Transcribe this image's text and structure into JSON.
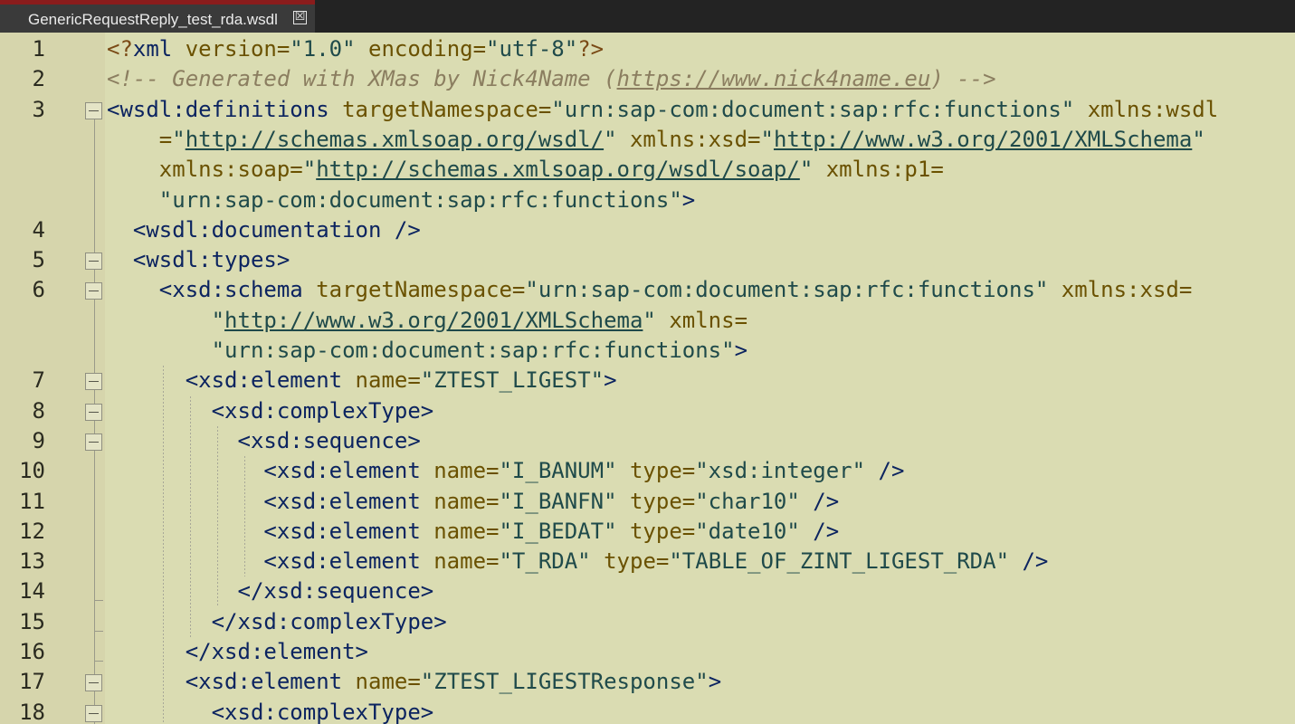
{
  "tab": {
    "title": "GenericRequestReply_test_rda.wsdl",
    "close_glyph": "☒"
  },
  "colors": {
    "editor_bg": "#dadcb2",
    "gutter_bg": "#d6d5ac",
    "tab_accent": "#8a1c1c",
    "tag": "#0c2460",
    "attr": "#6a5100",
    "value": "#1f4a4a",
    "comment": "#8b7e60"
  },
  "line_numbers": [
    "1",
    "2",
    "3",
    "4",
    "5",
    "6",
    "7",
    "8",
    "9",
    "10",
    "11",
    "12",
    "13",
    "14",
    "15",
    "16",
    "17",
    "18"
  ],
  "code": [
    {
      "seg": [
        [
          "pi",
          "<?"
        ],
        [
          "tag",
          "xml "
        ],
        [
          "attr",
          "version="
        ],
        [
          "val",
          "\"1.0\""
        ],
        [
          "attr",
          " encoding="
        ],
        [
          "val",
          "\"utf-8\""
        ],
        [
          "pi",
          "?>"
        ]
      ]
    },
    {
      "seg": [
        [
          "com",
          "<!-- Generated with XMas by Nick4Name ("
        ],
        [
          "com lnk",
          "https://www.nick4name.eu"
        ],
        [
          "com",
          ") -->"
        ]
      ]
    },
    {
      "seg": [
        [
          "tag",
          "<wsdl:definitions "
        ],
        [
          "attr",
          "targetNamespace="
        ],
        [
          "val",
          "\"urn:sap-com:document:sap:rfc:functions\""
        ],
        [
          "attr",
          " xmlns:wsdl"
        ]
      ]
    },
    {
      "seg": [
        [
          "attr",
          "    ="
        ],
        [
          "val",
          "\""
        ],
        [
          "val lnk",
          "http://schemas.xmlsoap.org/wsdl/"
        ],
        [
          "val",
          "\""
        ],
        [
          "attr",
          " xmlns:xsd="
        ],
        [
          "val",
          "\""
        ],
        [
          "val lnk",
          "http://www.w3.org/2001/XMLSchema"
        ],
        [
          "val",
          "\""
        ]
      ]
    },
    {
      "seg": [
        [
          "attr",
          "    xmlns:soap="
        ],
        [
          "val",
          "\""
        ],
        [
          "val lnk",
          "http://schemas.xmlsoap.org/wsdl/soap/"
        ],
        [
          "val",
          "\""
        ],
        [
          "attr",
          " xmlns:p1="
        ]
      ]
    },
    {
      "seg": [
        [
          "val",
          "    \"urn:sap-com:document:sap:rfc:functions\""
        ],
        [
          "tag",
          ">"
        ]
      ]
    },
    {
      "seg": [
        [
          "tag",
          "  <wsdl:documentation />"
        ]
      ]
    },
    {
      "seg": [
        [
          "tag",
          "  <wsdl:types>"
        ]
      ]
    },
    {
      "seg": [
        [
          "tag",
          "    <xsd:schema "
        ],
        [
          "attr",
          "targetNamespace="
        ],
        [
          "val",
          "\"urn:sap-com:document:sap:rfc:functions\""
        ],
        [
          "attr",
          " xmlns:xsd="
        ]
      ]
    },
    {
      "seg": [
        [
          "val",
          "        \""
        ],
        [
          "val lnk",
          "http://www.w3.org/2001/XMLSchema"
        ],
        [
          "val",
          "\""
        ],
        [
          "attr",
          " xmlns="
        ]
      ]
    },
    {
      "seg": [
        [
          "val",
          "        \"urn:sap-com:document:sap:rfc:functions\""
        ],
        [
          "tag",
          ">"
        ]
      ]
    },
    {
      "seg": [
        [
          "tag",
          "      <xsd:element "
        ],
        [
          "attr",
          "name="
        ],
        [
          "val",
          "\"ZTEST_LIGEST\""
        ],
        [
          "tag",
          ">"
        ]
      ]
    },
    {
      "seg": [
        [
          "tag",
          "        <xsd:complexType>"
        ]
      ]
    },
    {
      "seg": [
        [
          "tag",
          "          <xsd:sequence>"
        ]
      ]
    },
    {
      "seg": [
        [
          "tag",
          "            <xsd:element "
        ],
        [
          "attr",
          "name="
        ],
        [
          "val",
          "\"I_BANUM\""
        ],
        [
          "attr",
          " type="
        ],
        [
          "val",
          "\"xsd:integer\""
        ],
        [
          "tag",
          " />"
        ]
      ]
    },
    {
      "seg": [
        [
          "tag",
          "            <xsd:element "
        ],
        [
          "attr",
          "name="
        ],
        [
          "val",
          "\"I_BANFN\""
        ],
        [
          "attr",
          " type="
        ],
        [
          "val",
          "\"char10\""
        ],
        [
          "tag",
          " />"
        ]
      ]
    },
    {
      "seg": [
        [
          "tag",
          "            <xsd:element "
        ],
        [
          "attr",
          "name="
        ],
        [
          "val",
          "\"I_BEDAT\""
        ],
        [
          "attr",
          " type="
        ],
        [
          "val",
          "\"date10\""
        ],
        [
          "tag",
          " />"
        ]
      ]
    },
    {
      "seg": [
        [
          "tag",
          "            <xsd:element "
        ],
        [
          "attr",
          "name="
        ],
        [
          "val",
          "\"T_RDA\""
        ],
        [
          "attr",
          " type="
        ],
        [
          "val",
          "\"TABLE_OF_ZINT_LIGEST_RDA\""
        ],
        [
          "tag",
          " />"
        ]
      ]
    },
    {
      "seg": [
        [
          "tag",
          "          </xsd:sequence>"
        ]
      ]
    },
    {
      "seg": [
        [
          "tag",
          "        </xsd:complexType>"
        ]
      ]
    },
    {
      "seg": [
        [
          "tag",
          "      </xsd:element>"
        ]
      ]
    },
    {
      "seg": [
        [
          "tag",
          "      <xsd:element "
        ],
        [
          "attr",
          "name="
        ],
        [
          "val",
          "\"ZTEST_LIGESTResponse\""
        ],
        [
          "tag",
          ">"
        ]
      ]
    },
    {
      "seg": [
        [
          "tag",
          "        <xsd:complexType>"
        ]
      ]
    }
  ]
}
